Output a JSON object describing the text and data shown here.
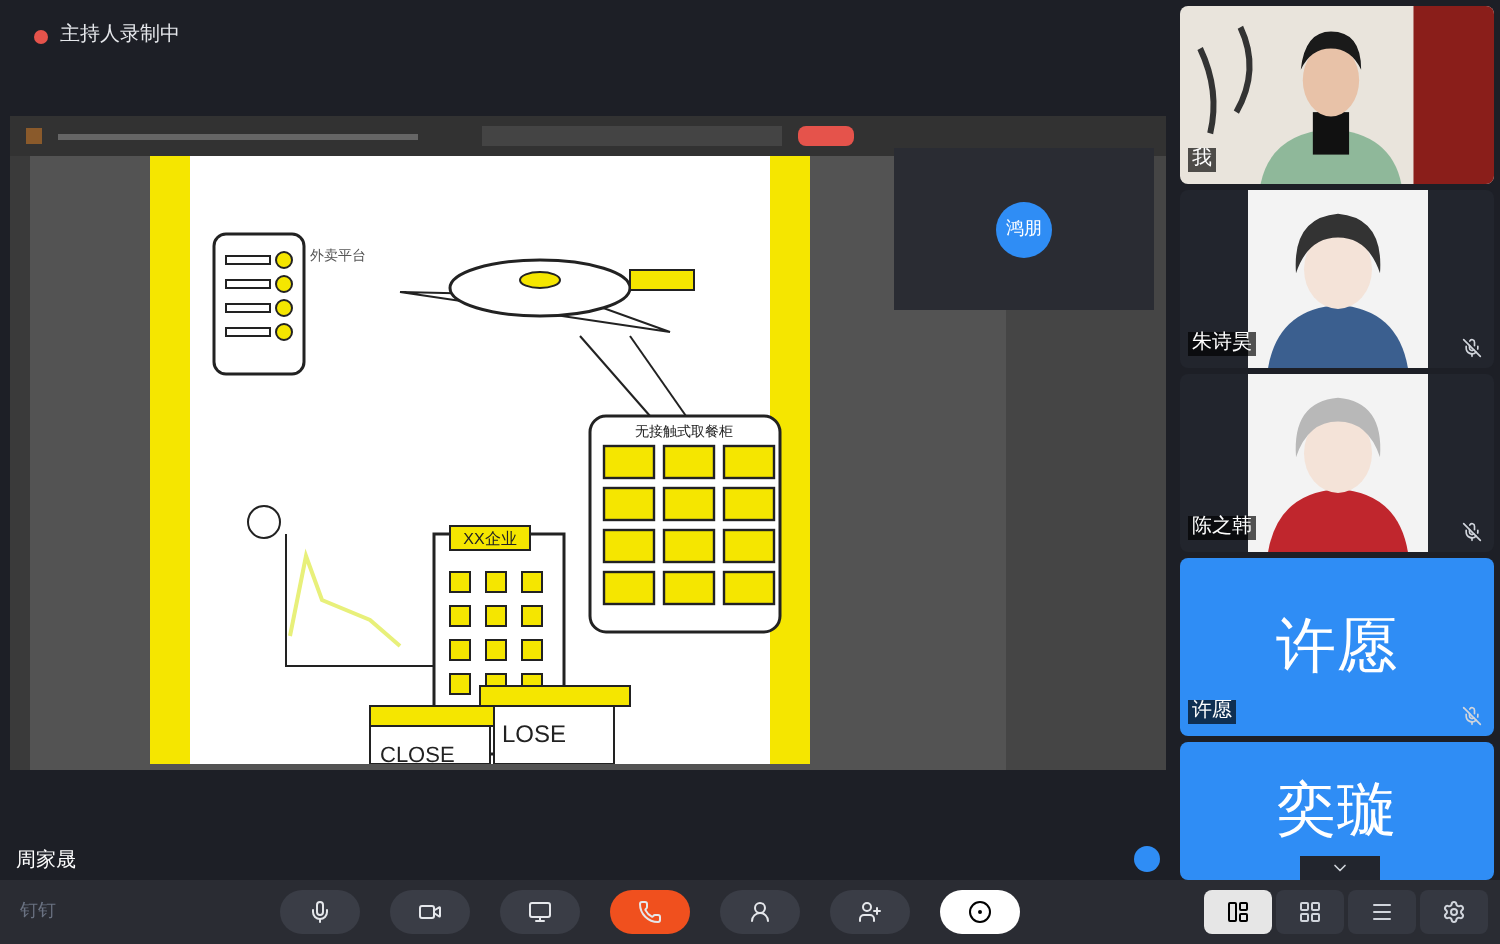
{
  "recording": {
    "label": "主持人录制中"
  },
  "shared_screen": {
    "presenter": "周家晟",
    "floating_video": {
      "initials": "鸿朋"
    },
    "artwork": {
      "platform_label": "外卖平台",
      "cabinet_label": "无接触式取餐柜",
      "company_label": "XX企业",
      "sign_left": "CLOSE",
      "sign_right": "LOSE"
    }
  },
  "participants": [
    {
      "name": "我",
      "kind": "camera",
      "mic_muted": false
    },
    {
      "name": "朱诗昊",
      "kind": "avatar",
      "mic_muted": true,
      "color": "#3b5f8f"
    },
    {
      "name": "陈之韩",
      "kind": "avatar",
      "mic_muted": true,
      "color": "#c0262d"
    },
    {
      "name": "许愿",
      "kind": "initials",
      "initials": "许愿",
      "mic_muted": true
    },
    {
      "kind": "initials",
      "initials": "奕璇",
      "mic_muted": false
    }
  ],
  "controls": [
    {
      "kind": "mic",
      "active": false
    },
    {
      "kind": "camera",
      "active": false
    },
    {
      "kind": "share",
      "active": false
    },
    {
      "kind": "hangup",
      "active": false
    },
    {
      "kind": "participants",
      "active": false
    },
    {
      "kind": "invite",
      "active": false
    },
    {
      "kind": "record",
      "active": true
    }
  ],
  "layouts": [
    {
      "kind": "speaker",
      "selected": true
    },
    {
      "kind": "grid",
      "selected": false
    },
    {
      "kind": "list",
      "selected": false
    },
    {
      "kind": "settings",
      "selected": false
    }
  ],
  "brand": "钉钉"
}
